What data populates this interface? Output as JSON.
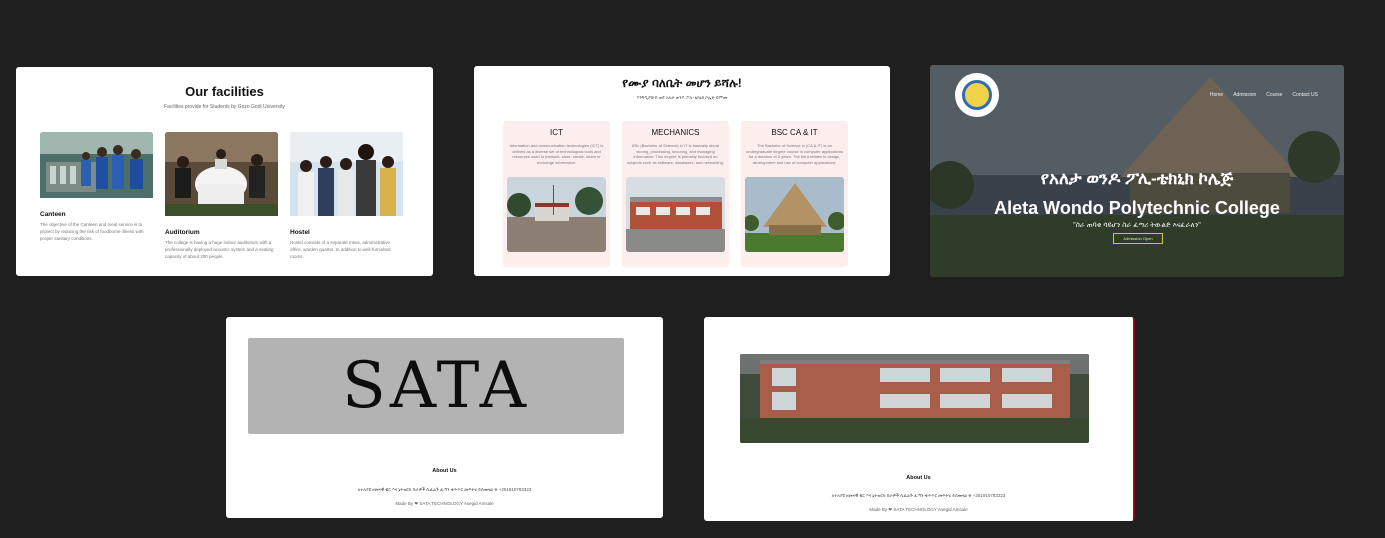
{
  "facilities": {
    "title": "Our facilities",
    "subtitle": "Facilities provide for Students by Gozo Godi University",
    "items": [
      {
        "name": "Canteen",
        "desc": "The objective of the Canteen and meal service is to protect by reducing the risk of foodborne illness with proper sanitary conditions."
      },
      {
        "name": "Auditorium",
        "desc": "The college is having a huge indoor auditorium with a professionally deployed acoustic system and a seating capacity of about 200 people."
      },
      {
        "name": "Hostel",
        "desc": "Hostel consists of a separate mess, administrative office, warden quarter. In addition to well-furnished rooms."
      }
    ]
  },
  "departments": {
    "title": "የሙያ ባለቤት መሆን ይሻሉ!",
    "subtitle": "እንግዲያውስ ወደ አለታ ወንዶ ፖሊ-ቴክኒክ ኮሌጅ ይምጡ",
    "items": [
      {
        "name": "ICT",
        "desc": "Information and communication technologies (ICT) is defined as a diverse set of technological tools and resources used to transmit, store, create, share or exchange information."
      },
      {
        "name": "MECHANICS",
        "desc": "BSc (Bachelor of Science) in IT is basically about storing, processing, securing, and managing information. This degree is primarily focused on subjects such as software, databases, and networking."
      },
      {
        "name": "BSC CA & IT",
        "desc": "The Bachelor of Science in (CA & IT) is an undergraduate degree course in computer applications for a duration of 3 years. The third relates to design, development and use of computer applications."
      }
    ]
  },
  "hero": {
    "nav": [
      "Home",
      "Admission",
      "Course",
      "Contact US"
    ],
    "title_am": "የአለታ ወንዶ ፖሊ-ቴክኒክ ኮሌጅ",
    "title_en": "Aleta Wondo Polytechnic College",
    "motto": "\"ስራ ጠባቂ ሳይሆን ስራ ፈጣሪ ትውልድ እናፈራለን\"",
    "button": "Admission Open"
  },
  "sata_page": {
    "banner": "SATA",
    "about_title": "About Us",
    "about_text": "ለተለያዩ ዘመናዊ ዌር እና ኔትወርክ ስራዎች ሲፈልጉ ፈጣን ቁጥጥር መፍትሄ ይሰጡናል ☎ +251910783323",
    "made_by": "Made By ❤ SATA TECHNOLOGY Asegid Amsale"
  },
  "building_page": {
    "about_title": "About Us",
    "about_text": "ለተለያዩ ዘመናዊ ዌር እና ኔትወርክ ስራዎች ሲፈልጉ ፈጣን ቁጥጥር መፍትሄ ይሰጡናል ☎ +251910783323",
    "made_by": "Made By ❤ SATA TECHNOLOGY Asegid Amsale"
  }
}
